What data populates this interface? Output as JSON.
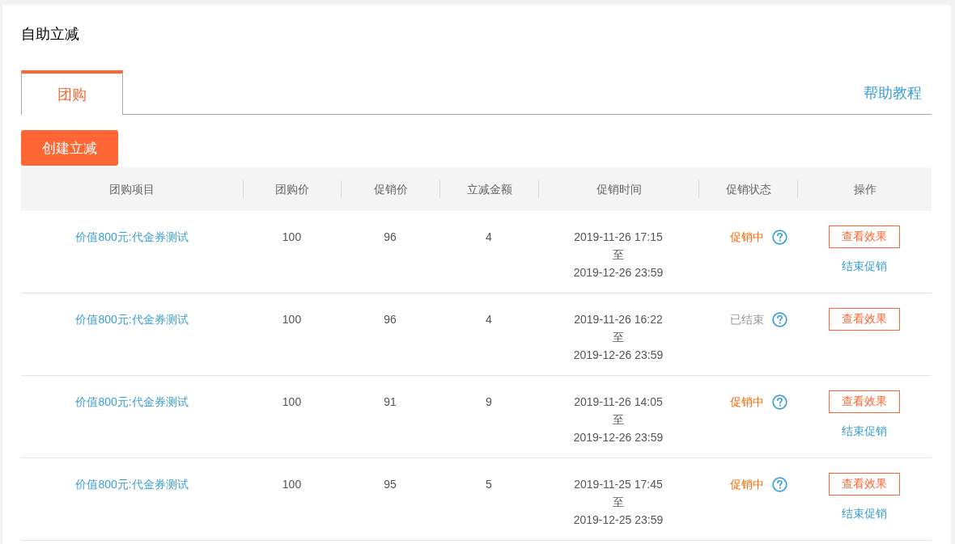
{
  "page_title": "自助立减",
  "tabs": [
    {
      "label": "团购",
      "selected": true
    }
  ],
  "help_link": "帮助教程",
  "create_button": "创建立减",
  "table": {
    "columns": [
      "团购项目",
      "团购价",
      "促销价",
      "立减金额",
      "促销时间",
      "促销状态",
      "操作"
    ],
    "rows": [
      {
        "item": "价值800元:代金券测试",
        "group_price": "100",
        "promo_price": "96",
        "discount": "4",
        "start": "2019-11-26 17:15",
        "separator": "至",
        "end": "2019-12-26 23:59",
        "status": {
          "label": "促销中",
          "active": true
        },
        "view_button": "查看效果",
        "end_link": "结束促销"
      },
      {
        "item": "价值800元:代金券测试",
        "group_price": "100",
        "promo_price": "96",
        "discount": "4",
        "start": "2019-11-26 16:22",
        "separator": "至",
        "end": "2019-12-26 23:59",
        "status": {
          "label": "已结束",
          "active": false
        },
        "view_button": "查看效果"
      },
      {
        "item": "价值800元:代金券测试",
        "group_price": "100",
        "promo_price": "91",
        "discount": "9",
        "start": "2019-11-26 14:05",
        "separator": "至",
        "end": "2019-12-26 23:59",
        "status": {
          "label": "促销中",
          "active": true
        },
        "view_button": "查看效果",
        "end_link": "结束促销"
      },
      {
        "item": "价值800元:代金券测试",
        "group_price": "100",
        "promo_price": "95",
        "discount": "5",
        "start": "2019-11-25 17:45",
        "separator": "至",
        "end": "2019-12-25 23:59",
        "status": {
          "label": "促销中",
          "active": true
        },
        "view_button": "查看效果",
        "end_link": "结束促销"
      }
    ]
  }
}
